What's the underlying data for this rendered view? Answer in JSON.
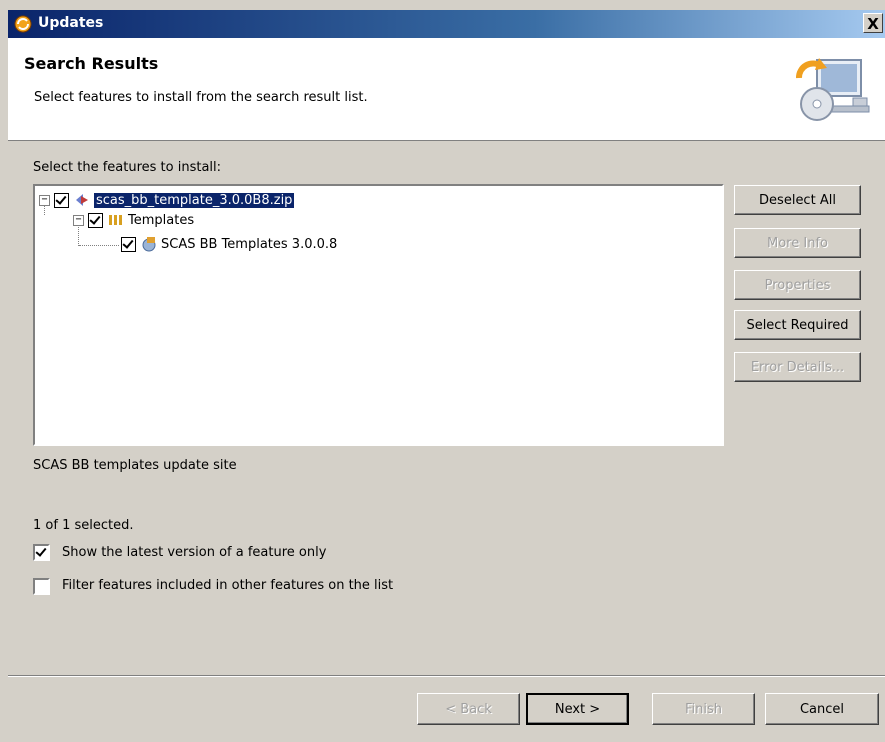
{
  "window": {
    "title": "Updates",
    "close_label": "X"
  },
  "header": {
    "title": "Search Results",
    "description": "Select features to install from the search result list."
  },
  "tree_label": "Select the features to install:",
  "tree": [
    {
      "label": "scas_bb_template_3.0.0B8.zip",
      "checked": true,
      "expanded": true,
      "selected": true,
      "icon": "site-icon"
    },
    {
      "label": "Templates",
      "checked": true,
      "expanded": true,
      "icon": "category-icon"
    },
    {
      "label": "SCAS BB Templates 3.0.0.8",
      "checked": true,
      "icon": "feature-icon"
    }
  ],
  "side_buttons": {
    "deselect_all": "Deselect All",
    "more_info": "More Info",
    "properties": "Properties",
    "select_required": "Select Required",
    "error_details": "Error Details..."
  },
  "site_description": "SCAS BB templates update site",
  "selection_status": "1 of 1 selected.",
  "options": {
    "latest_only": {
      "label": "Show the latest version of a feature only",
      "checked": true
    },
    "filter_included": {
      "label": "Filter features included in other features on the list",
      "checked": false
    }
  },
  "footer_buttons": {
    "back": "< Back",
    "next": "Next >",
    "finish": "Finish",
    "cancel": "Cancel"
  }
}
